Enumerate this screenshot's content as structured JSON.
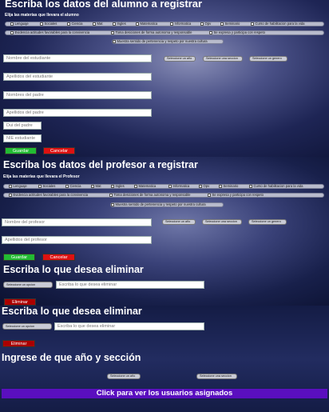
{
  "alumno": {
    "title": "Escriba los datos del alumno a registrar",
    "subtitle": "Elija las materias que llevara el alumno",
    "subjects_row1": [
      "Lenguaje",
      "Sociales",
      "Ciencia",
      "Mat",
      "Ingles",
      "Matematica",
      "Informatica",
      "Opv",
      "Seminario",
      "Curso de habilitacion para la vida"
    ],
    "subjects_row2": [
      "Evidencia actitudes favorables para la convivencia",
      "Toma desiciones de forma autonoma y responsable",
      "Se expresa y participa con respeto"
    ],
    "subjects_row3": [
      "Muestra sentido de pertenencia y respeto por nuestra cultura"
    ],
    "name_placeholder": "Nombre del estudiante",
    "year_select": "Seleccione un año",
    "section_select": "Seleccione una seccion",
    "gender_select": "Seleccione un genero",
    "lastname_placeholder": "Apellidos del estudiante",
    "father_name_placeholder": "Nombres del padre",
    "father_lastname_placeholder": "Apellidos del padre",
    "dui_placeholder": "Dui del padre",
    "nie_placeholder": "NIE estudiante",
    "save_label": "Guardar",
    "cancel_label": "Cancelar"
  },
  "profesor": {
    "title": "Escriba los datos del profesor a registrar",
    "subtitle": "Elija las materias que llevara el Profesor",
    "subjects_row1": [
      "Lenguaje",
      "Sociales",
      "Ciencia",
      "Mat",
      "Ingles",
      "Matematica",
      "Informatica",
      "Opv",
      "Seminario",
      "Curso de habilitacion para la vida"
    ],
    "subjects_row2": [
      "Evidencia actitudes favorables para la convivencia",
      "Toma desiciones de forma autonoma y responsable",
      "Se expresa y participa con respeto"
    ],
    "subjects_row3": [
      "Muestra sentido de pertenencia y respeto por nuestra cultura"
    ],
    "name_placeholder": "Nombre del profesor",
    "year_select": "Seleccione un año",
    "section_select": "Seleccione una seccion",
    "gender_select": "Seleccione un genero",
    "lastname_placeholder": "Apellidos del profesor",
    "save_label": "Guardar",
    "cancel_label": "Cancelar"
  },
  "eliminar1": {
    "title": "Escriba lo que desea eliminar",
    "option_select": "Seleccione un opcion",
    "input_placeholder": "Escriba lo que desea eliminar",
    "delete_label": "Eliminar"
  },
  "eliminar2": {
    "title": "Escriba lo que desea eliminar",
    "option_select": "Seleccione un opcion",
    "input_placeholder": "Escriba lo que desea eliminar",
    "delete_label": "Eliminar"
  },
  "asignados": {
    "title": "Ingrese de que año y sección",
    "year_select": "Seleccione un año",
    "section_select": "Seleccione una seccion",
    "view_label": "Click para ver los usuarios asignados"
  }
}
